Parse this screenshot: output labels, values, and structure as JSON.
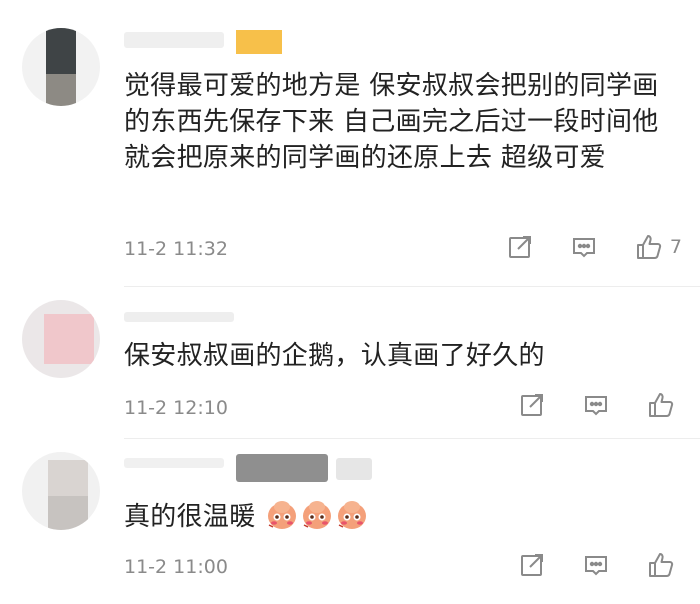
{
  "comments": [
    {
      "content": "觉得最可爱的地方是 保安叔叔会把别的同学画的东西先保存下来 自己画完之后过一段时间他就会把原来的同学画的还原上去 超级可爱",
      "time": "11-2 11:32",
      "like_count": "7"
    },
    {
      "content": "保安叔叔画的企鹅，认真画了好久的",
      "time": "11-2 12:10",
      "like_count": ""
    },
    {
      "content": "真的很温暖",
      "emojis": [
        "blush-emoji",
        "blush-emoji",
        "blush-emoji"
      ],
      "time": "11-2 11:00",
      "like_count": ""
    }
  ],
  "icons": {
    "share": "share-icon",
    "reply": "comment-icon",
    "like": "thumbs-up-icon"
  },
  "colors": {
    "text": "#222222",
    "meta": "#8a8a8a",
    "divider": "#ededed",
    "badge": "#f7c04a"
  }
}
